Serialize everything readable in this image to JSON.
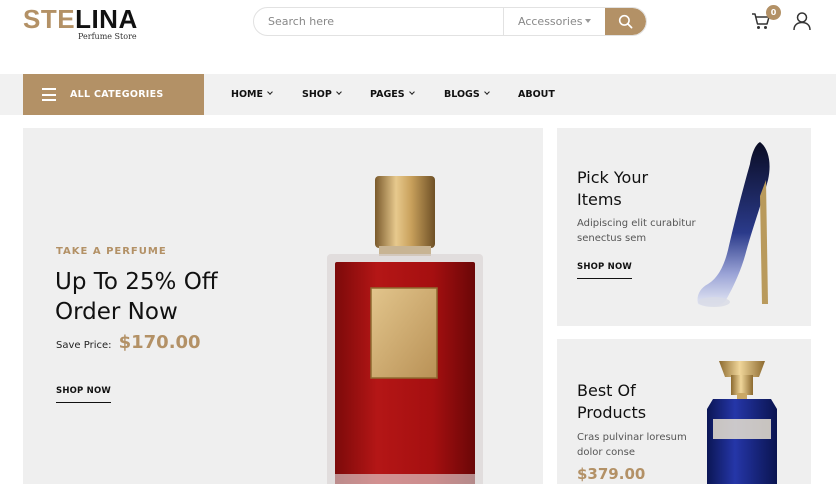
{
  "brand": {
    "name_part1": "STE",
    "name_part2": "LINA",
    "tagline": "Perfume Store"
  },
  "search": {
    "placeholder": "Search here",
    "category": "Accessories"
  },
  "cart": {
    "count": "0"
  },
  "nav": {
    "categories_label": "ALL CATEGORIES",
    "items": [
      {
        "label": "HOME",
        "has_dropdown": true
      },
      {
        "label": "SHOP",
        "has_dropdown": true
      },
      {
        "label": "PAGES",
        "has_dropdown": true
      },
      {
        "label": "BLOGS",
        "has_dropdown": true
      },
      {
        "label": "ABOUT",
        "has_dropdown": false
      }
    ]
  },
  "hero": {
    "tag": "TAKE A PERFUME",
    "title_line1": "Up To 25% Off",
    "title_line2": "Order Now",
    "price_label": "Save Price:",
    "price": "$170.00",
    "cta": "SHOP NOW"
  },
  "banners": [
    {
      "title_line1": "Pick Your",
      "title_line2": "Items",
      "desc_line1": "Adipiscing elit curabitur",
      "desc_line2": "senectus sem",
      "cta": "SHOP NOW"
    },
    {
      "title_line1": "Best Of",
      "title_line2": "Products",
      "desc_line1": "Cras pulvinar loresum",
      "desc_line2": "dolor conse",
      "price": "$379.00"
    }
  ],
  "colors": {
    "accent": "#b39166",
    "panel": "#efefef",
    "navbar": "#f1f1f1",
    "text": "#111111"
  },
  "icons": [
    "search-icon",
    "cart-icon",
    "user-icon",
    "menu-icon",
    "chevron-down-icon"
  ]
}
